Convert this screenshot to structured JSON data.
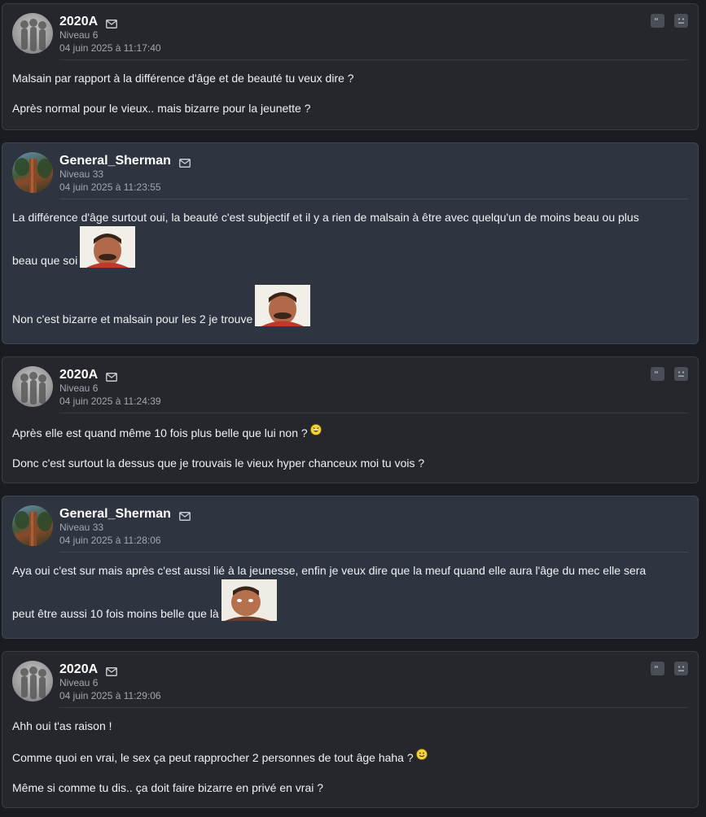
{
  "posts": [
    {
      "username": "2020A",
      "level": "Niveau 6",
      "date": "04 juin 2025 à 11:17:40",
      "avatar_icon": "silhouettes-avatar",
      "paragraphs": [
        "Malsain par rapport à la différence d'âge et de beauté tu veux dire ?",
        "Après normal pour le vieux.. mais bizarre pour la jeunette ?"
      ]
    },
    {
      "username": "General_Sherman",
      "level": "Niveau 33",
      "date": "04 juin 2025 à 11:23:55",
      "avatar_icon": "tree-avatar",
      "paragraphs": [
        "La différence d'âge surtout oui, la beauté c'est subjectif et il y a rien de malsain à être avec quelqu'un de moins beau ou plus",
        "beau que soi",
        "Non c'est bizarre et malsain pour les 2 je trouve"
      ]
    },
    {
      "username": "2020A",
      "level": "Niveau 6",
      "date": "04 juin 2025 à 11:24:39",
      "avatar_icon": "silhouettes-avatar",
      "paragraphs": [
        "Après elle est quand même 10 fois plus belle que lui non ?",
        "Donc c'est surtout la dessus que je trouvais le vieux hyper chanceux moi tu vois ?"
      ]
    },
    {
      "username": "General_Sherman",
      "level": "Niveau 33",
      "date": "04 juin 2025 à 11:28:06",
      "avatar_icon": "tree-avatar",
      "paragraphs": [
        "Aya oui c'est sur mais après c'est aussi lié à la jeunesse, enfin je veux dire que la meuf quand elle aura l'âge du mec elle sera",
        "peut être aussi 10 fois moins belle que là"
      ]
    },
    {
      "username": "2020A",
      "level": "Niveau 6",
      "date": "04 juin 2025 à 11:29:06",
      "avatar_icon": "silhouettes-avatar",
      "paragraphs": [
        "Ahh oui t'as raison !",
        "Comme quoi en vrai, le sex ça peut rapprocher 2 personnes de tout âge haha ?",
        "Même si comme tu dis.. ça doit faire bizarre en privé en vrai ?"
      ]
    }
  ],
  "icons": {
    "mail": "envelope-icon",
    "quote": "quote-icon",
    "report": "report-icon",
    "sticker": "risitas-sticker",
    "smiley_laugh": "laughing-smiley",
    "smiley_smile": "smile-smiley"
  },
  "colors": {
    "background": "#1b1c21",
    "post_bg": "#25272d",
    "post_alt_bg": "#2e3540",
    "meta_text": "#a3a7b0"
  }
}
